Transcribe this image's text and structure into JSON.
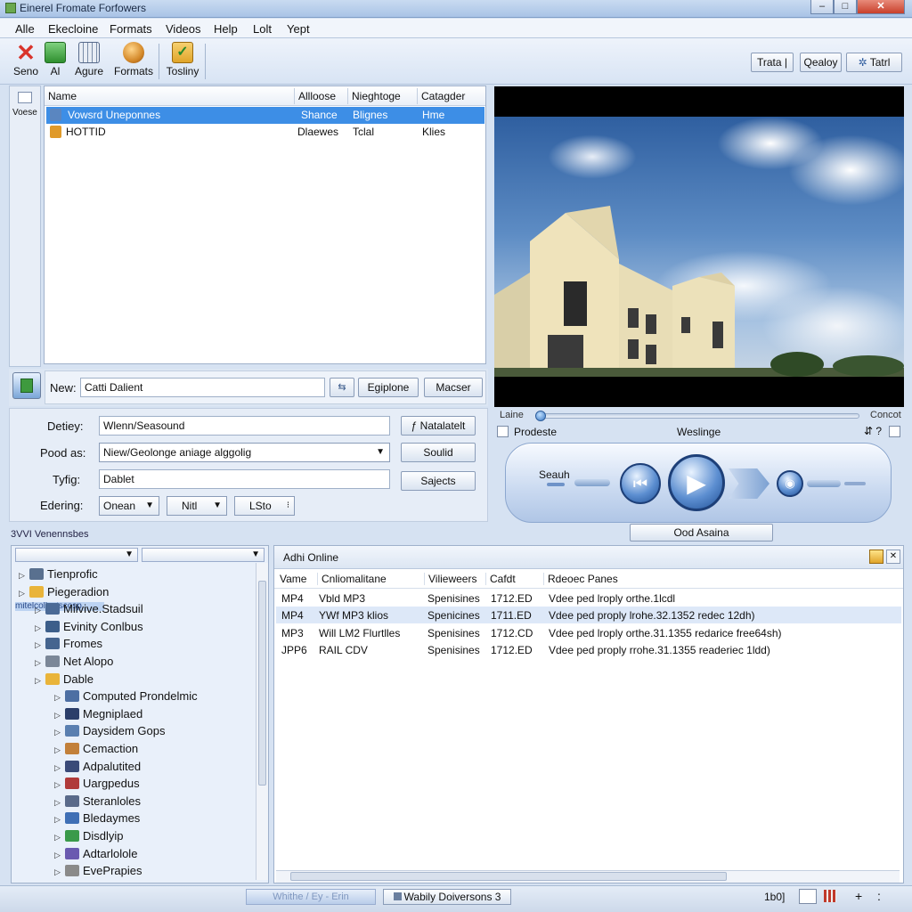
{
  "window": {
    "title": "Einerel Fromate Forfowers",
    "min": "–",
    "max": "□",
    "close": "✕"
  },
  "menu": [
    "Alle",
    "Ekecloine",
    "Formats",
    "Videos",
    "Help",
    "Lolt",
    "Yept"
  ],
  "toolbar": {
    "items": [
      {
        "label": "Seno",
        "icon": "delete-x-icon",
        "color": "#d9342b"
      },
      {
        "label": "Al",
        "icon": "green-box-icon",
        "color": "#3fa33f"
      },
      {
        "label": "Agure",
        "icon": "keyboard-icon",
        "color": "#7a8da8"
      },
      {
        "label": "Formats",
        "icon": "globe-figure-icon",
        "color": "#d4892a"
      },
      {
        "label": "Tosliny",
        "icon": "shield-check-icon",
        "color": "#e0a52a"
      }
    ],
    "tosliny_sub": "\"",
    "right_buttons": [
      "Trata",
      "|",
      "Qealoy",
      "Tatrl"
    ]
  },
  "leftstrip": {
    "label": "Voese"
  },
  "filelist": {
    "columns": [
      "Name",
      "Allloose",
      "Nieghtoge",
      "Catagder"
    ],
    "rows": [
      {
        "name": "Vowsrd Uneponnes",
        "c2": "Shance",
        "c3": "Blignes",
        "c4": "Hme",
        "selected": true,
        "iconColor": "#5a86c0"
      },
      {
        "name": "HOTTID",
        "c2": "Dlaewes",
        "c3": "Tclal",
        "c4": "Klies",
        "selected": false,
        "iconColor": "#e09a2a"
      }
    ]
  },
  "namebar": {
    "label": "New:",
    "value": "Catti Dalient",
    "btn_icon": "swap-arrows-icon",
    "explore": "Egiplone",
    "master": "Macser"
  },
  "props": {
    "fields": [
      {
        "label": "Detiey:",
        "value": "Wlenn/Seasound",
        "button": "Natalatelt"
      },
      {
        "label": "Pood as:",
        "value": "Niew/Geolonge aniage alggolig",
        "button": "Soulid"
      },
      {
        "label": "Tyfig:",
        "value": "Dablet",
        "button": "Sajects"
      }
    ],
    "edering_label": "Edering:",
    "dropdowns": [
      "Onean",
      "Nitl",
      "LSto"
    ]
  },
  "player": {
    "left_label": "Laine",
    "right_label": "Concot",
    "seek": 0.0,
    "prodesto": "Prodeste",
    "weslinge": "Weslinge",
    "right_icons": "⇵ ?",
    "search_label": "Seauh",
    "bottom_button": "Ood Asaina"
  },
  "tree": {
    "label": "3VVI Venennsbes",
    "highlight": "mitelcolby.iscosp",
    "items": [
      {
        "text": "Tienprofic",
        "level": 0,
        "color": "#59708f"
      },
      {
        "text": "Piegeradion",
        "level": 0,
        "color": "#e9b43a"
      },
      {
        "text": "Milvive.Stadsuil",
        "level": 1,
        "color": "#4b6a96"
      },
      {
        "text": "Evinity Conlbus",
        "level": 1,
        "color": "#3c5e8a"
      },
      {
        "text": "Fromes",
        "level": 1,
        "color": "#45648f"
      },
      {
        "text": "Net Alopo",
        "level": 1,
        "color": "#7b8798"
      },
      {
        "text": "Dable",
        "level": 1,
        "color": "#e9b43a"
      },
      {
        "text": "Computed Prondelmic",
        "level": 2,
        "color": "#4d6fa3"
      },
      {
        "text": "Megniplaed",
        "level": 2,
        "color": "#2b3e6a"
      },
      {
        "text": "Daysidem Gops",
        "level": 2,
        "color": "#5a7fb0"
      },
      {
        "text": "Cemaction",
        "level": 2,
        "color": "#c2803a"
      },
      {
        "text": "Adpalutited",
        "level": 2,
        "color": "#3a4a78"
      },
      {
        "text": "Uargpedus",
        "level": 2,
        "color": "#b03a3a"
      },
      {
        "text": "Steranloles",
        "level": 2,
        "color": "#5a6a8a"
      },
      {
        "text": "Bledaymes",
        "level": 2,
        "color": "#3f6fb5"
      },
      {
        "text": "Disdlyip",
        "level": 2,
        "color": "#3a9a4a"
      },
      {
        "text": "Adtarlolole",
        "level": 2,
        "color": "#6a5ab0"
      },
      {
        "text": "EvePrapies",
        "level": 2,
        "color": "#8a8a8a"
      }
    ]
  },
  "table": {
    "title": "Adhi Online",
    "columns": [
      "Vame",
      "Cnliomalitane",
      "Vilieweers",
      "Cafdt",
      "Rdeoec Panes"
    ],
    "rows": [
      [
        "MP4",
        "Vbld MP3",
        "Spenisines",
        "1712.ED",
        "Vdee ped lroply orthe.1lcdl"
      ],
      [
        "MP4",
        "YWf MP3 klios",
        "Spenicines",
        "1711.ED",
        "Vdee ped proply lrohe.32.1352 redec 12dh)"
      ],
      [
        "MP3",
        "Will LM2 Flurtlles",
        "Spenisines",
        "1712.CD",
        "Vdee ped lroply orthe.31.1355 redarice free64sh)"
      ],
      [
        "JPP6",
        "RAIL CDV",
        "Spenisines",
        "1712.ED",
        "Vdee ped proply rrohe.31.1355 readeriec 1ldd)"
      ]
    ]
  },
  "status": {
    "left": "Whithe / Ey - Erin",
    "center": "Wabily Doiversons 3",
    "num": "1b0]",
    "plus": "+",
    "colon": ":"
  }
}
